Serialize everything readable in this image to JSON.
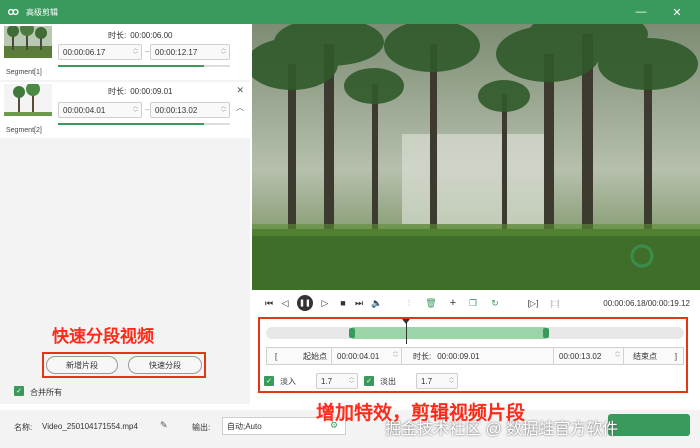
{
  "window": {
    "title": "高级剪辑",
    "colors": {
      "accent": "#3a9a5e",
      "annotation": "#ff2a1a"
    }
  },
  "segments": [
    {
      "label": "Segment[1]",
      "duration_label": "时长:",
      "duration": "00:00:06.00",
      "start": "00:00:06.17",
      "end": "00:00:12.17",
      "progress": 0.85
    },
    {
      "label": "Segment[2]",
      "duration_label": "时长:",
      "duration": "00:00:09.01",
      "start": "00:00:04.01",
      "end": "00:00:13.02",
      "progress": 0.85
    }
  ],
  "left_panel": {
    "annotation": "快速分段视频",
    "add_segment_button": "新增片段",
    "quick_split_button": "快速分段",
    "merge_all_label": "合并所有"
  },
  "player": {
    "time_display": "00:00:06.18/00:00:19.12"
  },
  "edit": {
    "start_button": "起始点",
    "start_time": "00:00:04.01",
    "duration_label": "时长:",
    "duration": "00:00:09.01",
    "end_time": "00:00:13.02",
    "end_button": "结束点",
    "fade_in_label": "淡入",
    "fade_in_value": "1.7",
    "fade_out_label": "淡出",
    "fade_out_value": "1.7",
    "selection_start": 0.205,
    "selection_end": 0.67,
    "playhead": 0.335
  },
  "annotation_bottom": "增加特效，剪辑视频片段",
  "footer": {
    "name_label": "名称:",
    "file_name": "Video_250104171554.mp4",
    "output_label": "输出:",
    "output_value": "自动;Auto"
  },
  "watermark": "掘金技术社区 @ 数据蛙官方软件"
}
